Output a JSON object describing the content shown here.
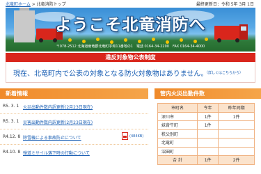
{
  "breadcrumb": {
    "home": "北竜町ホーム",
    "separator": " > ",
    "current": "北竜消防トップ"
  },
  "updated": "最終更新日：令和 5年 3月 1日",
  "banner": {
    "title": "ようこそ北竜消防へ",
    "address": "〒078-2512 北海道雨竜郡北竜町字和11番地の1　電話 0164-34-2200　FAX 0164-34-4000"
  },
  "notice": {
    "heading": "違反対象物公表制度",
    "text": "現在、北竜町内で公表の対象となる防火対象物はありません。",
    "detail": "（詳しくはこちらから）"
  },
  "news": {
    "heading": "新着情報",
    "items": [
      {
        "date": "R5. 3. 1",
        "title": "火災出動件数内訳更新(2月23日現在)"
      },
      {
        "date": "R5. 3. 1",
        "title": "災害出動件数内訳更新(2月23日現在)"
      },
      {
        "date": "R4.12. 8",
        "title": "除雪機による事故防止について",
        "file": "(484KB)"
      },
      {
        "date": "R4.10. 8",
        "title": "弾道ミサイル落下時の行動について"
      }
    ]
  },
  "fire_stats": {
    "heading": "管内火災出動件数",
    "columns": [
      "市町名",
      "今年",
      "昨年同期"
    ],
    "rows": [
      [
        "深川市",
        "1件",
        "1件"
      ],
      [
        "妹背牛町",
        "1件",
        ""
      ],
      [
        "秩父別町",
        "",
        ""
      ],
      [
        "北竜町",
        "",
        ""
      ],
      [
        "沼田町",
        "",
        ""
      ],
      [
        "合 計",
        "1件",
        "2件"
      ]
    ]
  },
  "colors": {
    "accent_red": "#d9261c",
    "accent_orange": "#f08a2a",
    "link_blue": "#1a5fb4"
  }
}
